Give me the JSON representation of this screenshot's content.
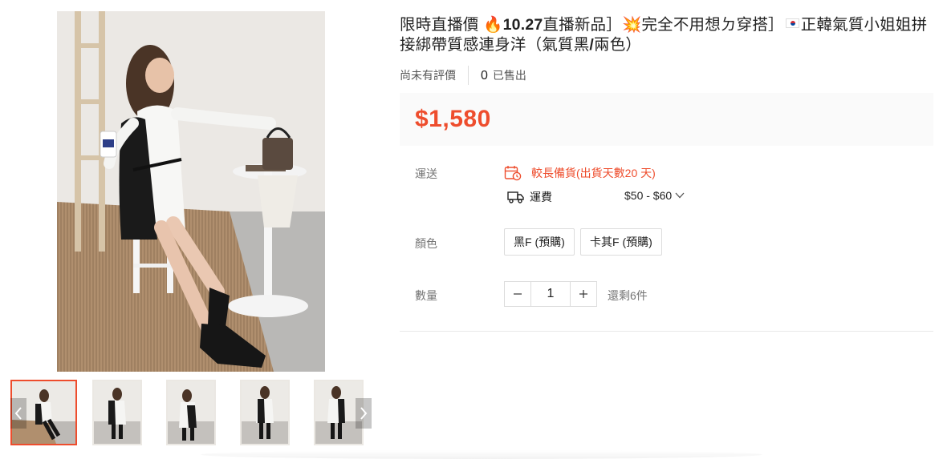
{
  "product": {
    "title_part1": "限時直播價 ",
    "title_fire": "🔥",
    "title_bold": "10.27",
    "title_part2": "直播新品］",
    "title_boom": "💥",
    "title_part3": "完全不用想ㄉ穿搭］",
    "title_part4": "正韓氣質小姐姐拼接綁帶質感連身洋（氣質黑",
    "title_slash": "/",
    "title_part5": "兩色）",
    "rating_text": "尚未有評價",
    "sold_count": "0",
    "sold_label": "已售出",
    "price": "$1,580"
  },
  "shipping": {
    "label": "運送",
    "preorder_text": "較長備貨(出貨天數20 天)",
    "fee_label": "運費",
    "fee_range": "$50 - $60"
  },
  "color": {
    "label": "顏色",
    "options": [
      "黑F (預購)",
      "卡其F (預購)"
    ]
  },
  "quantity": {
    "label": "數量",
    "value": "1",
    "stock_text": "還剩6件"
  },
  "gallery": {
    "thumb_count": 5,
    "active_index": 0
  },
  "colors": {
    "accent": "#ee4d2d",
    "price_bg": "#fafafa"
  },
  "icons": [
    "calendar-clock-icon",
    "truck-icon",
    "chevron-down-icon",
    "minus-icon",
    "plus-icon",
    "chevron-left-icon",
    "chevron-right-icon"
  ]
}
